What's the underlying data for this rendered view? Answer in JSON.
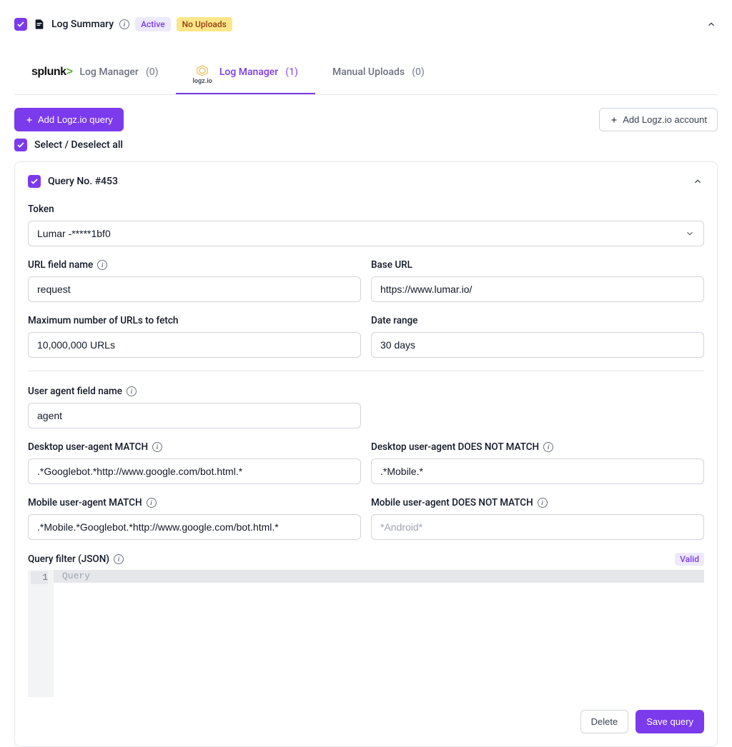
{
  "header": {
    "title": "Log Summary",
    "badge_active": "Active",
    "badge_warn": "No Uploads"
  },
  "tabs": {
    "splunk": {
      "label": "Log Manager",
      "count": "(0)",
      "logo_text": "splunk"
    },
    "logzio": {
      "label": "Log Manager",
      "count": "(1)",
      "logo_text": "logz.io"
    },
    "manual": {
      "label": "Manual Uploads",
      "count": "(0)"
    }
  },
  "actions": {
    "add_query": "Add Logz.io query",
    "add_account": "Add Logz.io account",
    "select_all": "Select / Deselect all"
  },
  "card": {
    "title": "Query No. #453",
    "token_label": "Token",
    "token_value": "Lumar -*****1bf0",
    "url_field_label": "URL field name",
    "url_field_value": "request",
    "base_url_label": "Base URL",
    "base_url_value": "https://www.lumar.io/",
    "max_urls_label": "Maximum number of URLs to fetch",
    "max_urls_value": "10,000,000 URLs",
    "date_range_label": "Date range",
    "date_range_value": "30 days",
    "ua_field_label": "User agent field name",
    "ua_field_value": "agent",
    "desktop_match_label": "Desktop user-agent MATCH",
    "desktop_match_value": ".*Googlebot.*http://www.google.com/bot.html.*",
    "desktop_nomatch_label": "Desktop user-agent DOES NOT MATCH",
    "desktop_nomatch_value": ".*Mobile.*",
    "mobile_match_label": "Mobile user-agent MATCH",
    "mobile_match_value": ".*Mobile.*Googlebot.*http://www.google.com/bot.html.*",
    "mobile_nomatch_label": "Mobile user-agent DOES NOT MATCH",
    "mobile_nomatch_placeholder": "*Android*",
    "query_filter_label": "Query filter (JSON)",
    "query_filter_valid": "Valid",
    "query_filter_placeholder": "Query",
    "line_number": "1",
    "delete_label": "Delete",
    "save_label": "Save query"
  }
}
